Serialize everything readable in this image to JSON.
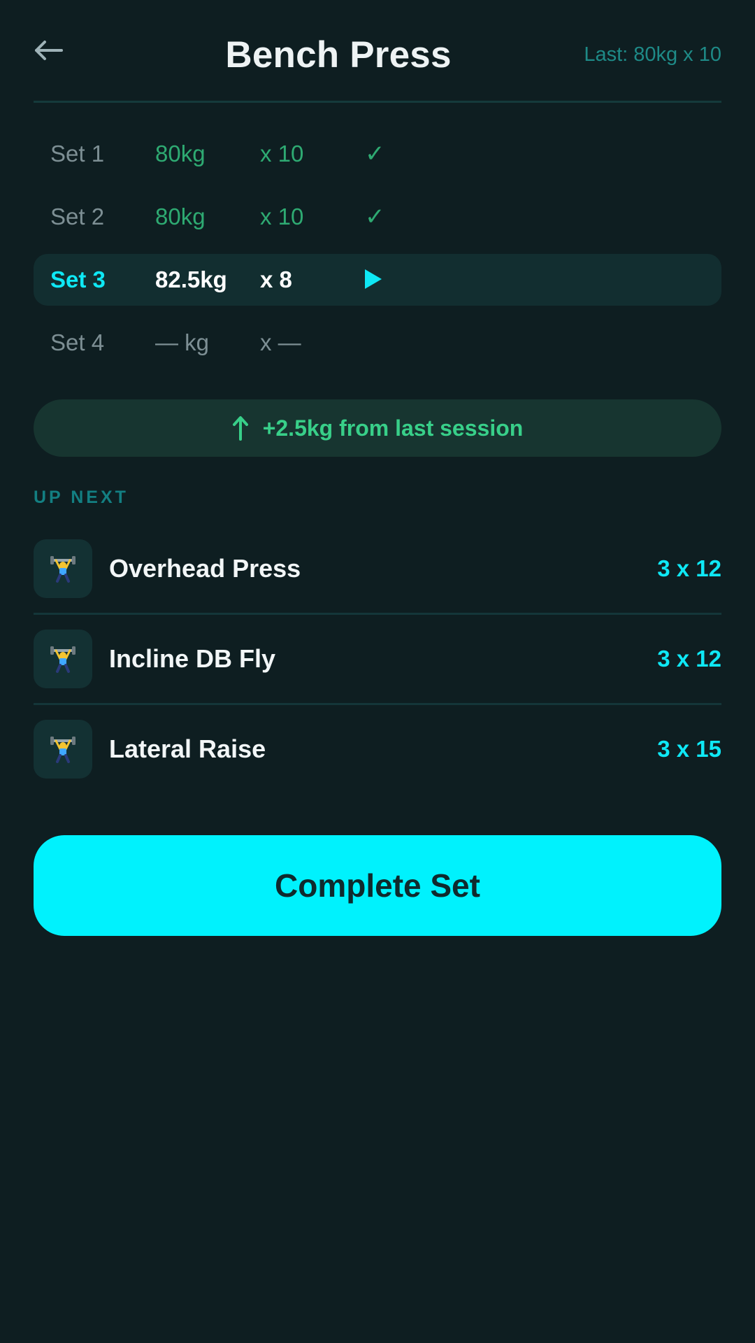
{
  "header": {
    "title": "Bench Press",
    "last": "Last: 80kg x 10"
  },
  "sets": [
    {
      "label": "Set 1",
      "weight": "80kg",
      "reps": "x 10",
      "status": "done",
      "status_symbol": "✓"
    },
    {
      "label": "Set 2",
      "weight": "80kg",
      "reps": "x 10",
      "status": "done",
      "status_symbol": "✓"
    },
    {
      "label": "Set 3",
      "weight": "82.5kg",
      "reps": "x 8",
      "status": "active"
    },
    {
      "label": "Set 4",
      "weight": "— kg",
      "reps": "x —",
      "status": "pending"
    }
  ],
  "progress": {
    "text": "+2.5kg from last session",
    "icon": "arrow-up-icon"
  },
  "up_next": {
    "label": "UP NEXT",
    "items": [
      {
        "name": "Overhead Press",
        "sets": "3 x 12",
        "icon": "weightlifter-icon"
      },
      {
        "name": "Incline DB Fly",
        "sets": "3 x 12",
        "icon": "weightlifter-icon"
      },
      {
        "name": "Lateral Raise",
        "sets": "3 x 15",
        "icon": "weightlifter-icon"
      }
    ]
  },
  "cta": {
    "label": "Complete Set"
  },
  "colors": {
    "background": "#0e1e21",
    "accent": "#00f2fd",
    "success": "#2eaa72",
    "muted": "#7d8f94"
  }
}
